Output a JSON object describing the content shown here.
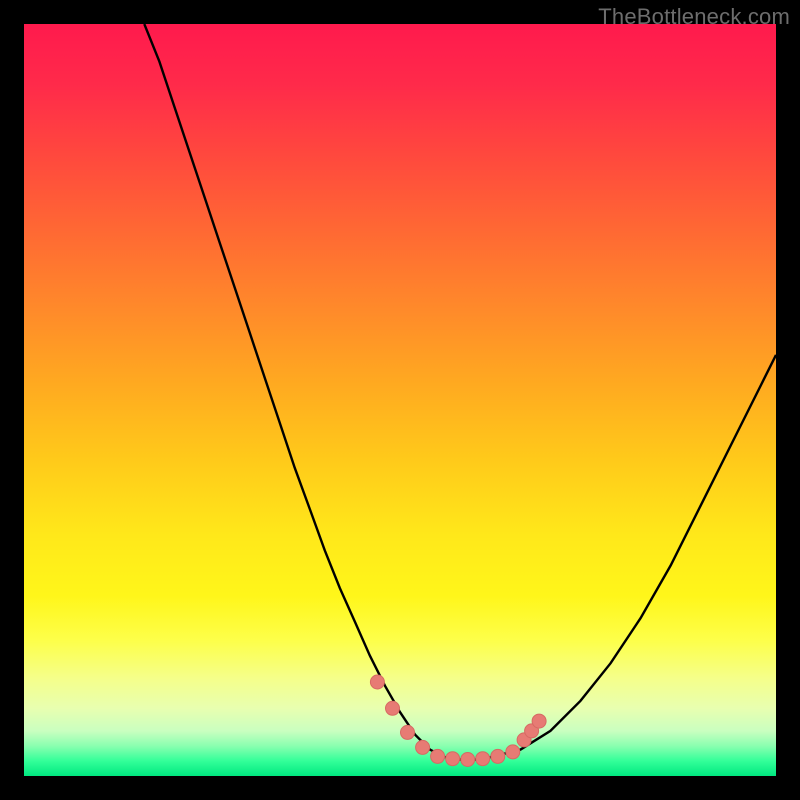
{
  "watermark": "TheBottleneck.com",
  "colors": {
    "frame": "#000000",
    "curve_stroke": "#000000",
    "marker_fill": "#e77b74",
    "marker_stroke": "#d66a63"
  },
  "chart_data": {
    "type": "line",
    "title": "",
    "xlabel": "",
    "ylabel": "",
    "xlim": [
      0,
      100
    ],
    "ylim": [
      0,
      100
    ],
    "series": [
      {
        "name": "bottleneck-curve",
        "x": [
          16,
          18,
          20,
          22,
          24,
          26,
          28,
          30,
          32,
          34,
          36,
          38,
          40,
          42,
          44,
          46,
          48,
          50,
          52,
          54,
          56,
          58,
          60,
          62,
          66,
          70,
          74,
          78,
          82,
          86,
          90,
          94,
          98,
          100
        ],
        "y": [
          100,
          95,
          89,
          83,
          77,
          71,
          65,
          59,
          53,
          47,
          41,
          35.5,
          30,
          25,
          20.5,
          16,
          12,
          8.5,
          5.5,
          3.5,
          2.5,
          2.2,
          2.2,
          2.5,
          3.5,
          6,
          10,
          15,
          21,
          28,
          36,
          44,
          52,
          56
        ]
      }
    ],
    "markers": {
      "name": "dip-markers",
      "points": [
        {
          "x": 47,
          "y": 12.5
        },
        {
          "x": 49,
          "y": 9
        },
        {
          "x": 51,
          "y": 5.8
        },
        {
          "x": 53,
          "y": 3.8
        },
        {
          "x": 55,
          "y": 2.6
        },
        {
          "x": 57,
          "y": 2.3
        },
        {
          "x": 59,
          "y": 2.2
        },
        {
          "x": 61,
          "y": 2.3
        },
        {
          "x": 63,
          "y": 2.6
        },
        {
          "x": 65,
          "y": 3.2
        },
        {
          "x": 66.5,
          "y": 4.8
        },
        {
          "x": 67.5,
          "y": 6.0
        },
        {
          "x": 68.5,
          "y": 7.3
        }
      ]
    }
  }
}
